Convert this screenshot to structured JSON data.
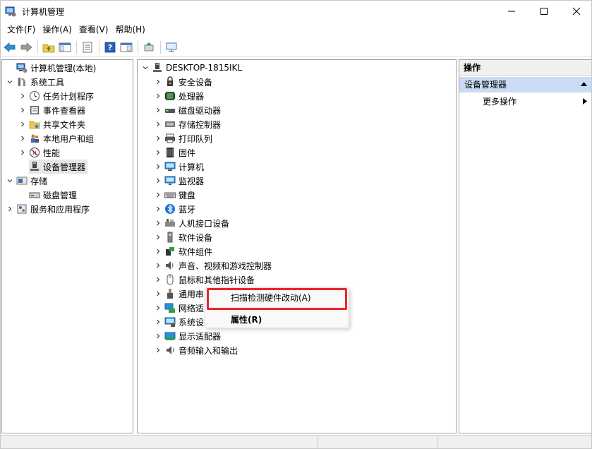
{
  "window": {
    "title": "计算机管理",
    "controls": [
      "minimize-icon",
      "maximize-icon",
      "close-icon"
    ]
  },
  "menu": [
    {
      "label": "文件(F)"
    },
    {
      "label": "操作(A)"
    },
    {
      "label": "查看(V)"
    },
    {
      "label": "帮助(H)"
    }
  ],
  "toolbar": {
    "buttons": [
      "back-arrow-icon",
      "forward-arrow-icon",
      "up-folder-icon",
      "show-hide-tree-icon",
      "export-list-icon",
      "help-icon",
      "action-pane-icon",
      "update-driver-icon",
      "scan-hardware-icon"
    ]
  },
  "left_tree": [
    {
      "label": "计算机管理(本地)",
      "icon": "computer-management-icon",
      "expand": "",
      "level": 0
    },
    {
      "label": "系统工具",
      "icon": "tools-icon",
      "expand": "expanded",
      "level": 0
    },
    {
      "label": "任务计划程序",
      "icon": "clock-icon",
      "expand": "collapsed",
      "level": 1
    },
    {
      "label": "事件查看器",
      "icon": "event-viewer-icon",
      "expand": "collapsed",
      "level": 1
    },
    {
      "label": "共享文件夹",
      "icon": "shared-folder-icon",
      "expand": "collapsed",
      "level": 1
    },
    {
      "label": "本地用户和组",
      "icon": "users-icon",
      "expand": "collapsed",
      "level": 1
    },
    {
      "label": "性能",
      "icon": "performance-icon",
      "expand": "collapsed",
      "level": 1
    },
    {
      "label": "设备管理器",
      "icon": "device-manager-icon",
      "expand": "",
      "level": 1,
      "selected": true
    },
    {
      "label": "存储",
      "icon": "storage-icon",
      "expand": "expanded",
      "level": 0
    },
    {
      "label": "磁盘管理",
      "icon": "disk-management-icon",
      "expand": "",
      "level": 1
    },
    {
      "label": "服务和应用程序",
      "icon": "services-icon",
      "expand": "collapsed",
      "level": 0
    }
  ],
  "device_tree": {
    "root": {
      "label": "DESKTOP-1815IKL",
      "icon": "computer-root-icon"
    },
    "categories": [
      {
        "label": "安全设备",
        "icon": "security-device-icon"
      },
      {
        "label": "处理器",
        "icon": "processor-icon"
      },
      {
        "label": "磁盘驱动器",
        "icon": "disk-drive-icon"
      },
      {
        "label": "存储控制器",
        "icon": "storage-controller-icon"
      },
      {
        "label": "打印队列",
        "icon": "printer-icon"
      },
      {
        "label": "固件",
        "icon": "firmware-icon"
      },
      {
        "label": "计算机",
        "icon": "computer-icon"
      },
      {
        "label": "监视器",
        "icon": "monitor-icon"
      },
      {
        "label": "键盘",
        "icon": "keyboard-icon"
      },
      {
        "label": "蓝牙",
        "icon": "bluetooth-icon"
      },
      {
        "label": "人机接口设备",
        "icon": "hid-icon"
      },
      {
        "label": "软件设备",
        "icon": "software-device-icon"
      },
      {
        "label": "软件组件",
        "icon": "software-component-icon"
      },
      {
        "label": "声音、视频和游戏控制器",
        "icon": "sound-icon"
      },
      {
        "label": "鼠标和其他指针设备",
        "icon": "mouse-icon"
      },
      {
        "label": "通用串",
        "icon": "usb-icon"
      },
      {
        "label": "网络适",
        "icon": "network-adapter-icon"
      },
      {
        "label": "系统设",
        "icon": "system-device-icon"
      },
      {
        "label": "显示适配器",
        "icon": "display-adapter-icon"
      },
      {
        "label": "音频输入和输出",
        "icon": "audio-io-icon"
      }
    ]
  },
  "actions_pane": {
    "header": "操作",
    "section": "设备管理器",
    "more": "更多操作"
  },
  "context_menu": {
    "items": [
      {
        "label": "扫描检测硬件改动(A)",
        "bold": false
      },
      {
        "label": "属性(R)",
        "bold": true
      }
    ],
    "highlight_color": "#e8262c"
  },
  "colors": {
    "selection": "#e5e5e5",
    "actions_section": "#c9dcf3",
    "accent": "#0078d7"
  }
}
